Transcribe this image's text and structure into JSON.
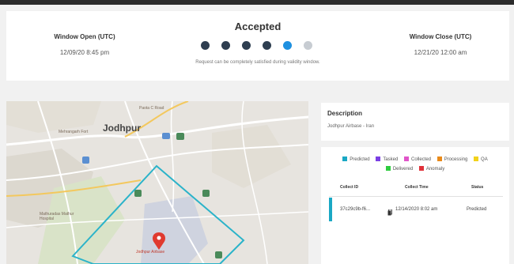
{
  "status": {
    "window_open_label": "Window Open (UTC)",
    "window_open_value": "12/09/20 8:45 pm",
    "window_close_label": "Window Close (UTC)",
    "window_close_value": "12/21/20 12:00 am",
    "title": "Accepted",
    "message": "Request can be completely satisfied during validity window.",
    "progress": {
      "steps_total": 6,
      "steps_complete": 4,
      "current_step": 5
    },
    "colors": {
      "complete": "#2e3e50",
      "current": "#1e90e0",
      "pending": "#c7ccd2"
    }
  },
  "map": {
    "city_label": "Jodhpur",
    "airbase_label": "Jodhpur Airbase",
    "labels": [
      "Mehrangarh Fort",
      "Mathuradas Mathur Hospital",
      "Paota C Road"
    ],
    "footprint_color": "#2bb3c9",
    "pin_color": "#e03a2f"
  },
  "description": {
    "title": "Description",
    "text": "Jodhpur Airbase - Iran"
  },
  "legend": [
    {
      "label": "Predicted",
      "color": "#1aa8c4"
    },
    {
      "label": "Tasked",
      "color": "#7b3fe4"
    },
    {
      "label": "Collected",
      "color": "#e055c9"
    },
    {
      "label": "Processing",
      "color": "#e98a1a"
    },
    {
      "label": "QA",
      "color": "#f2d21b"
    },
    {
      "label": "Delivered",
      "color": "#2ecc40"
    },
    {
      "label": "Anomaly",
      "color": "#e0323a"
    }
  ],
  "table": {
    "headers": {
      "collect_id": "Collect ID",
      "collect_time": "Collect Time",
      "status": "Status"
    },
    "rows": [
      {
        "collect_id": "37c29c9b-f6...",
        "collect_time": "12/14/2020 8:02 am",
        "status": "Predicted",
        "status_color": "#1aa8c4"
      }
    ]
  }
}
